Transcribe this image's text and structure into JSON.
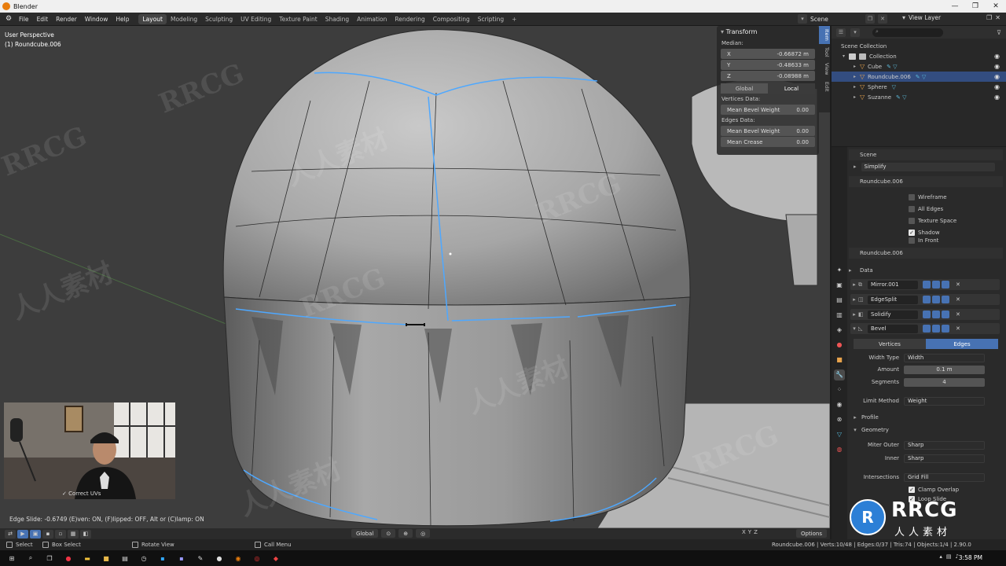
{
  "window": {
    "title": "Blender",
    "controls": [
      "—",
      "❐",
      "✕"
    ]
  },
  "menu": [
    "File",
    "Edit",
    "Render",
    "Window",
    "Help"
  ],
  "workspaces": [
    "Layout",
    "Modeling",
    "Sculpting",
    "UV Editing",
    "Texture Paint",
    "Shading",
    "Animation",
    "Rendering",
    "Compositing",
    "Scripting",
    "+"
  ],
  "active_workspace": "Layout",
  "scene_label": "Scene",
  "view_layer_label": "View Layer",
  "viewport": {
    "perspective": "User Perspective",
    "object": "(1) Roundcube.006",
    "status": "Edge Slide: -0.6749 (E)ven: ON, (F)lipped: OFF, Alt or (C)lamp: ON",
    "watermarks": [
      "RRCG",
      "人人素材",
      "RRCG",
      "人人素材",
      "RRCG",
      "人人素材",
      "RRCG",
      "人人素材",
      "RRCG"
    ]
  },
  "transform_panel": {
    "title": "Transform",
    "median_label": "Median:",
    "median": [
      {
        "axis": "X",
        "value": "-0.66872 m"
      },
      {
        "axis": "Y",
        "value": "-0.48633 m"
      },
      {
        "axis": "Z",
        "value": "-0.08988 m"
      }
    ],
    "space": [
      "Global",
      "Local"
    ],
    "vertices_label": "Vertices Data:",
    "vertices": [
      {
        "name": "Mean Bevel Weight",
        "value": "0.00"
      }
    ],
    "edges_label": "Edges Data:",
    "edges": [
      {
        "name": "Mean Bevel Weight",
        "value": "0.00"
      },
      {
        "name": "Mean Crease",
        "value": "0.00"
      }
    ]
  },
  "side_tabs": [
    "Item",
    "Tool",
    "View",
    "Edit"
  ],
  "webcam": {
    "caption": "✓ Correct UVs"
  },
  "viewport_header": {
    "orientation": "Global",
    "axes": [
      "X",
      "Y",
      "Z"
    ],
    "options": "Options"
  },
  "status_bar": {
    "select": "Select",
    "box_select": "Box Select",
    "rotate_view": "Rotate View",
    "call_menu": "Call Menu",
    "stats": "Roundcube.006 | Verts:10/48 | Edges:0/37 | Tris:74 | Objects:1/4 | 2.90.0"
  },
  "taskbar": {
    "time": "3:58 PM"
  },
  "outliner": {
    "root": "Scene Collection",
    "collection": "Collection",
    "items": [
      {
        "name": "Cube",
        "selected": false
      },
      {
        "name": "Roundcube.006",
        "selected": true
      },
      {
        "name": "Sphere",
        "selected": false
      },
      {
        "name": "Suzanne",
        "selected": false
      }
    ]
  },
  "properties": {
    "scene_title": "Scene",
    "simplify": "Simplify",
    "object_title": "Roundcube.006",
    "viewport_display": [
      "Wireframe",
      "All Edges",
      "Texture Space",
      "Shadow",
      "In Front"
    ],
    "viewport_display_checked": [
      false,
      false,
      false,
      true,
      false
    ],
    "modifier_object": "Roundcube.006",
    "data_label": "Data",
    "modifiers": [
      "Mirror.001",
      "EdgeSplit",
      "Solidify",
      "Bevel"
    ],
    "bevel": {
      "affect": [
        "Vertices",
        "Edges"
      ],
      "width_type_label": "Width Type",
      "width_type": "Width",
      "amount_label": "Amount",
      "amount": "0.1 m",
      "segments_label": "Segments",
      "segments": "4",
      "limit_method_label": "Limit Method",
      "limit_method": "Weight",
      "profile_label": "Profile",
      "geometry_label": "Geometry",
      "miter_outer_label": "Miter Outer",
      "miter_outer": "Sharp",
      "inner_label": "Inner",
      "inner": "Sharp",
      "intersection_label": "Intersections",
      "intersection": "Grid Fill",
      "clamp_overlap": "Clamp Overlap",
      "loop_slide": "Loop Slide"
    }
  },
  "branding": {
    "logo": "RRCG",
    "sub": "人人素材"
  },
  "colors": {
    "accent": "#4772b3",
    "selected_edge": "#4ea8ff",
    "mesh": "#9a9a9a"
  }
}
